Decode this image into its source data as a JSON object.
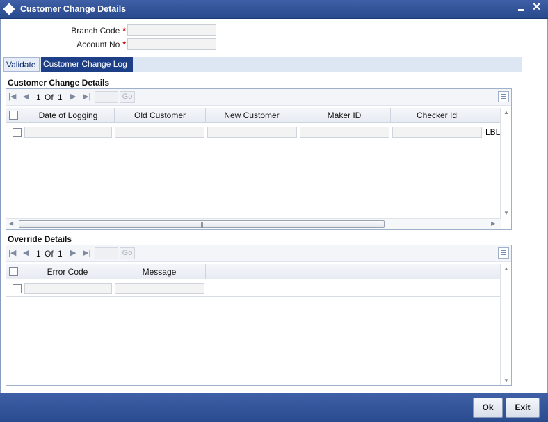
{
  "window": {
    "title": "Customer Change Details"
  },
  "form": {
    "branch_code_label": "Branch Code",
    "branch_code_value": "",
    "account_no_label": "Account No",
    "account_no_value": "",
    "required_mark": "*"
  },
  "tabs": [
    {
      "label": "Validate",
      "active": false
    },
    {
      "label": "Customer Change Log",
      "active": true
    }
  ],
  "customer_change": {
    "section_title": "Customer Change Details",
    "pager": {
      "current": "1",
      "of_label": "Of",
      "total": "1",
      "go_label": "Go"
    },
    "columns": [
      "Date of Logging",
      "Old Customer",
      "New Customer",
      "Maker ID",
      "Checker Id"
    ],
    "rows": [
      {
        "cells": [
          "",
          "",
          "",
          "",
          ""
        ],
        "overflow_text": "LBL"
      }
    ]
  },
  "override": {
    "section_title": "Override Details",
    "pager": {
      "current": "1",
      "of_label": "Of",
      "total": "1",
      "go_label": "Go"
    },
    "columns": [
      "Error Code",
      "Message"
    ],
    "rows": [
      {
        "cells": [
          "",
          ""
        ]
      }
    ]
  },
  "footer": {
    "ok_label": "Ok",
    "exit_label": "Exit"
  },
  "icons": [
    "window-diamond-icon",
    "minimize-icon",
    "close-icon",
    "first-page-icon",
    "prev-page-icon",
    "next-page-icon",
    "last-page-icon",
    "list-view-icon",
    "scroll-up-icon",
    "scroll-down-icon",
    "scroll-left-icon",
    "scroll-right-icon"
  ],
  "colors": {
    "titlebar": "#2f4f96",
    "active_tab": "#1d3f87",
    "required": "#cc0000"
  }
}
